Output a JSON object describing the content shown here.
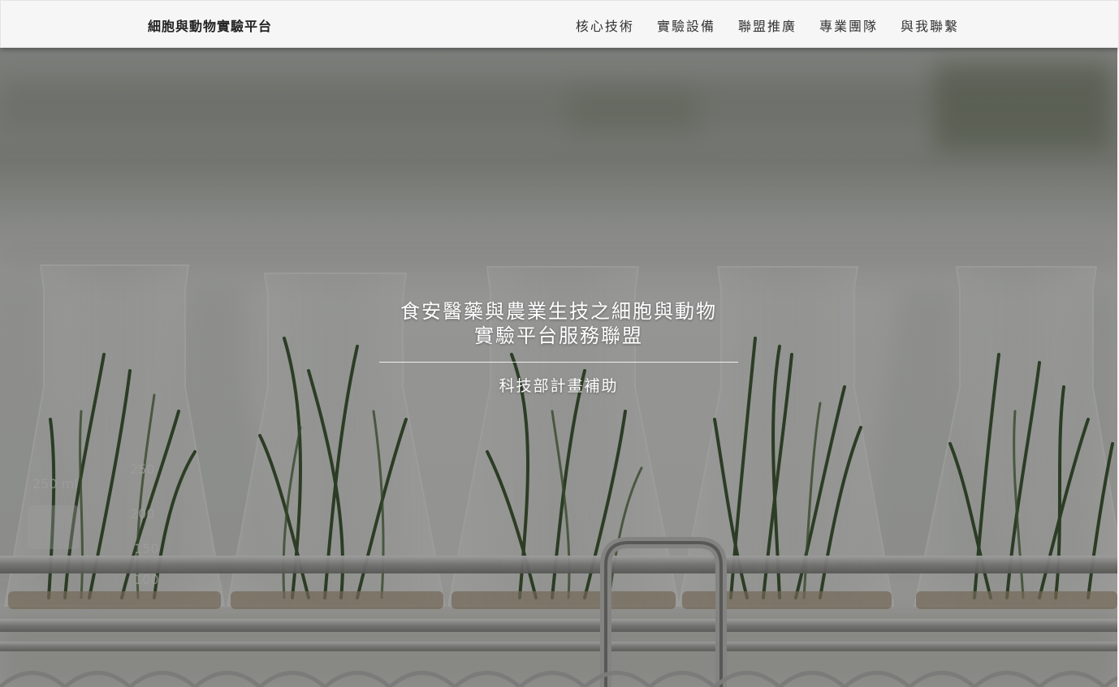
{
  "navbar": {
    "brand": "細胞與動物實驗平台",
    "links": [
      {
        "label": "核心技術"
      },
      {
        "label": "實驗設備"
      },
      {
        "label": "聯盟推廣"
      },
      {
        "label": "專業團隊"
      },
      {
        "label": "與我聯繫"
      }
    ]
  },
  "hero": {
    "title_line1": "食安醫藥與農業生技之細胞與動物",
    "title_line2": "實驗平台服務聯盟",
    "subtitle": "科技部計畫補助",
    "background_icon": "lab-flasks-with-plants-photo"
  },
  "colors": {
    "navbar_bg": "#f6f6f6",
    "brand_text": "#222222",
    "nav_text": "#333333",
    "hero_text": "#ffffff",
    "overlay": "rgba(0,0,0,0.38)"
  }
}
